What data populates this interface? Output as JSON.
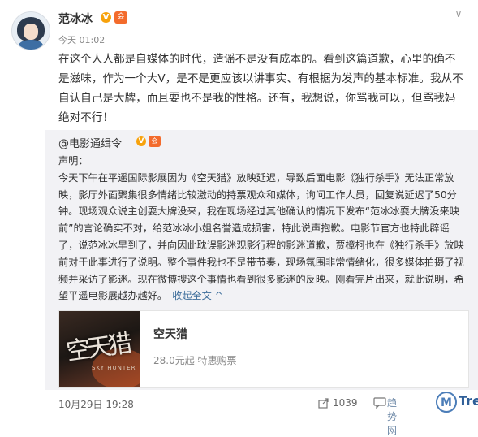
{
  "post": {
    "author": "范冰冰",
    "verified_badge": "V",
    "level_badge": "会",
    "timestamp": "今天 01:02",
    "text": "在这个人人都是自媒体的时代，造谣不是没有成本的。看到这篇道歉，心里的确不是滋味，作为一个大V，是不是更应该以讲事实、有根据为发声的基本标准。我从不自认自己是大牌，而且耍也不是我的性格。还有，我想说，你骂我可以，但骂我妈绝对不行！"
  },
  "repost": {
    "author": "@电影通缉令",
    "verified_badge": "V",
    "level_badge": "会",
    "text": "声明：\n今天下午在平遥国际影展因为《空天猎》放映延迟，导致后面电影《独行杀手》无法正常放映，影厅外面聚集很多情绪比较激动的持票观众和媒体，询问工作人员，回复说延迟了50分钟。现场观众说主创耍大牌没来，我在现场经过其他确认的情况下发布“范冰冰耍大牌没来映前”的言论确实不对，给范冰冰小姐名誉造成损害，特此说声抱歉。电影节官方也特此辟谣了，说范冰冰早到了，并向因此耽误影迷观影行程的影迷道歉，贾樟柯也在《独行杀手》放映前对于此事进行了说明。整个事件我也不是带节奏，现场氛围非常情绪化，很多媒体拍摄了视频并采访了影迷。现在微博搜这个事情也看到很多影迷的反映。刚看完片出来，就此说明，希望平遥电影展越办越好。",
    "collapse_label": "收起全文 ^",
    "card": {
      "poster_text": "空天猎",
      "poster_subtitle": "SKY HUNTER",
      "title": "空天猎",
      "price": "28.0元起 特惠购票"
    }
  },
  "footer": {
    "date": "10月29日 19:28",
    "share_count": "1039"
  },
  "watermark": {
    "text1": "趋势 网",
    "circle": "M",
    "text2": "Trend"
  },
  "colors": {
    "link": "#3f6f9c",
    "badge_gold": "#f7a20b",
    "badge_orange": "#f36b2c",
    "repost_bg": "#f2f2f5"
  },
  "icons": [
    "avatar",
    "chevron-down-icon",
    "verified-icon",
    "member-icon",
    "share-icon",
    "comment-icon"
  ]
}
